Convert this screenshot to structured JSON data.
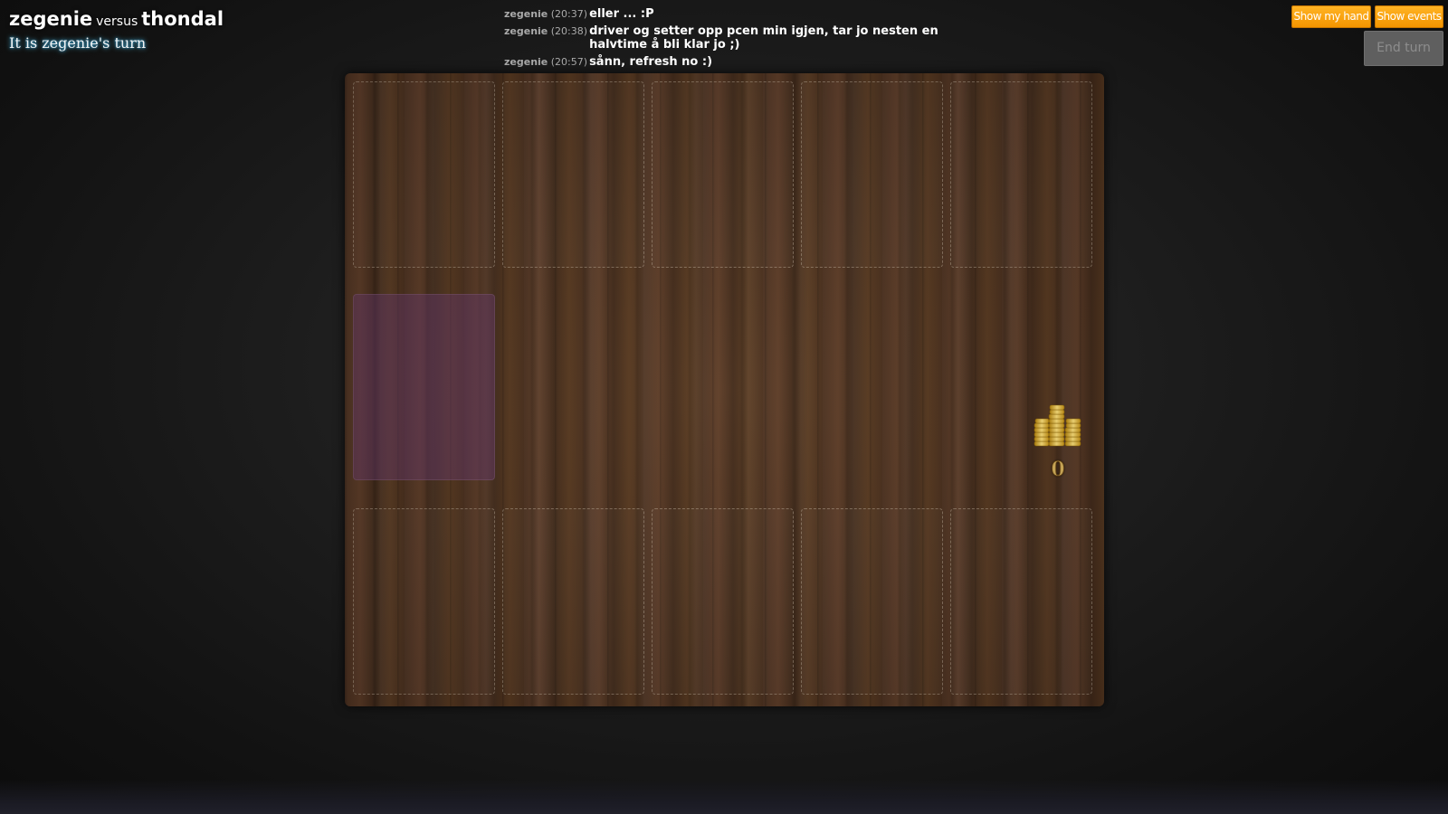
{
  "header": {
    "player1": "zegenie",
    "versus": "versus",
    "player2": "thondal",
    "turn_status": "It is zegenie's turn"
  },
  "chat": {
    "messages": [
      {
        "user": "zegenie",
        "time": "(20:37)",
        "text": "eller ... :P"
      },
      {
        "user": "zegenie",
        "time": "(20:38)",
        "text": "driver og setter opp pcen min igjen, tar jo nesten en halvtime å bli klar jo ;)"
      },
      {
        "user": "zegenie",
        "time": "(20:57)",
        "text": "sånn, refresh no :)"
      }
    ]
  },
  "buttons": {
    "show_my_hand": "Show my hand",
    "show_events": "Show events",
    "end_turn": "End turn"
  },
  "board": {
    "gold_counter": "0",
    "icons": {
      "gold": "gold-coins-icon"
    }
  },
  "colors": {
    "accent_orange": "#f8a000",
    "hand_slot_purple": "#693773",
    "board_wood": "#4a3020"
  }
}
